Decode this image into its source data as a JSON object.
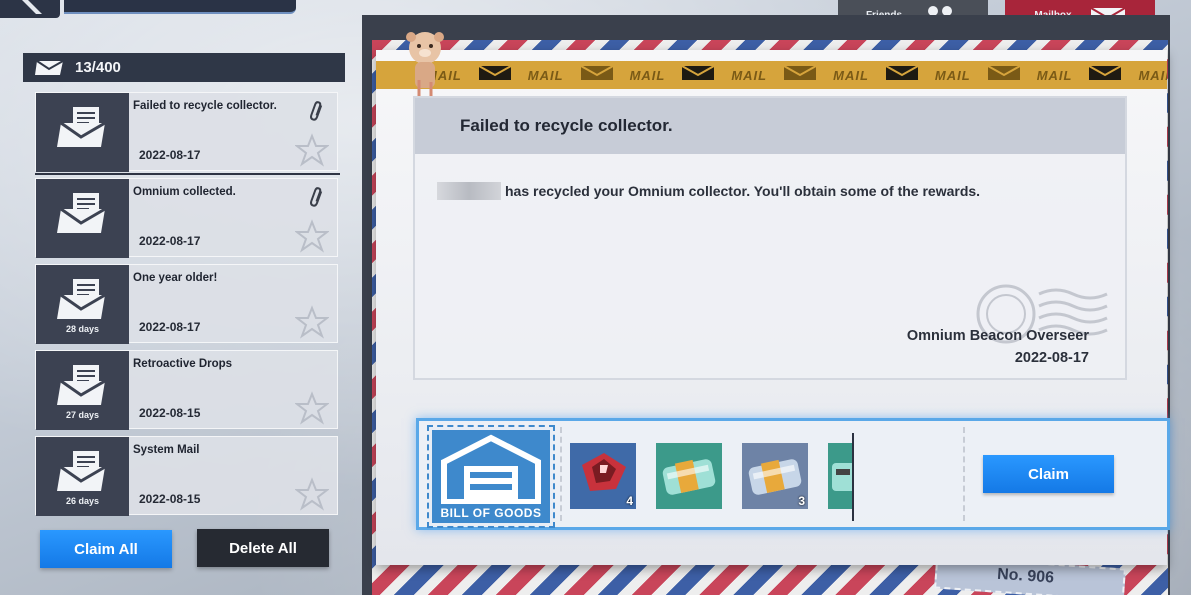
{
  "tabs": {
    "friends": "Friends",
    "mailbox": "Mailbox"
  },
  "mailbox": {
    "count": "13/400"
  },
  "mail_list": [
    {
      "title": "Failed to recycle collector.",
      "date": "2022-08-17",
      "days": "",
      "attachment": true,
      "selected": true
    },
    {
      "title": "Omnium collected.",
      "date": "2022-08-17",
      "days": "",
      "attachment": true,
      "selected": false
    },
    {
      "title": "One year older!",
      "date": "2022-08-17",
      "days": "28 days",
      "attachment": false,
      "selected": false
    },
    {
      "title": "Retroactive Drops",
      "date": "2022-08-15",
      "days": "27 days",
      "attachment": false,
      "selected": false
    },
    {
      "title": "System Mail",
      "date": "2022-08-15",
      "days": "26 days",
      "attachment": false,
      "selected": false
    }
  ],
  "buttons": {
    "claim_all": "Claim All",
    "delete_all": "Delete All",
    "claim": "Claim"
  },
  "letter": {
    "tape_word": "MAIL",
    "title": "Failed to recycle collector.",
    "body": "has recycled your Omnium collector. You'll obtain some of the rewards.",
    "sender": "Omnium Beacon Overseer",
    "date": "2022-08-17"
  },
  "rewards": {
    "bill_label": "BILL OF GOODS",
    "items": [
      {
        "icon": "red-crystal-icon",
        "count": "4"
      },
      {
        "icon": "teal-capsule-icon",
        "count": ""
      },
      {
        "icon": "blue-capsule-icon",
        "count": "3"
      },
      {
        "icon": "teal-item-icon",
        "count": ""
      }
    ]
  },
  "stamp": {
    "text": "No. 906"
  }
}
